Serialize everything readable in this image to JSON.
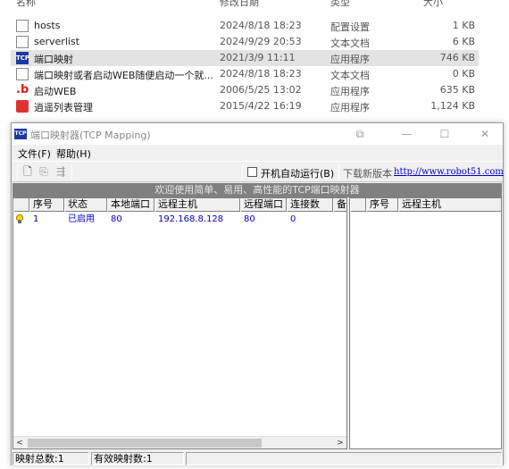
{
  "explorer": {
    "columns": {
      "name": "名称",
      "date": "修改日期",
      "type": "类型",
      "size": "大小"
    },
    "files": [
      {
        "name": "hosts",
        "date": "2024/8/18 18:23",
        "type": "配置设置",
        "size": "1 KB",
        "icon": "file-icon"
      },
      {
        "name": "serverlist",
        "date": "2024/9/29 20:53",
        "type": "文本文档",
        "size": "6 KB",
        "icon": "file-icon"
      },
      {
        "name": "端口映射",
        "date": "2021/3/9 11:11",
        "type": "应用程序",
        "size": "746 KB",
        "icon": "tcp-app-icon",
        "selected": true
      },
      {
        "name": "端口映射或者启动WEB随便启动一个就...",
        "date": "2024/8/18 18:23",
        "type": "文本文档",
        "size": "0 KB",
        "icon": "file-icon"
      },
      {
        "name": "启动WEB",
        "date": "2006/5/25 13:02",
        "type": "应用程序",
        "size": "635 KB",
        "icon": "b-app-icon"
      },
      {
        "name": "逍遥列表管理",
        "date": "2015/4/22 16:19",
        "type": "应用程序",
        "size": "1,124 KB",
        "icon": "gift-app-icon"
      }
    ]
  },
  "app": {
    "icon_label": "TCP",
    "title": "端口映射器(TCP Mapping)",
    "window_controls": {
      "minimize": "—",
      "maximize": "☐",
      "close": "✕",
      "extra": "⧉"
    },
    "menu": {
      "file": "文件(F)",
      "help": "帮助(H)"
    },
    "toolbar": {
      "autostart_label": "开机自动运行(B)",
      "autostart_checked": false,
      "download_label": "下载新版本",
      "download_url_text": "http://www.robot51.com"
    },
    "banner": "欢迎使用简单、易用、高性能的TCP端口映射器",
    "left_table": {
      "columns": [
        "序号",
        "状态",
        "本地端口",
        "远程主机",
        "远程端口",
        "连接数",
        "备"
      ],
      "rows": [
        {
          "index": "1",
          "status": "已启用",
          "local_port": "80",
          "remote_host": "192.168.8.128",
          "remote_port": "80",
          "connections": "0"
        }
      ]
    },
    "right_table": {
      "columns": [
        "序号",
        "远程主机"
      ]
    },
    "statusbar": {
      "total": "映射总数:1",
      "active": "有效映射数:1"
    }
  }
}
